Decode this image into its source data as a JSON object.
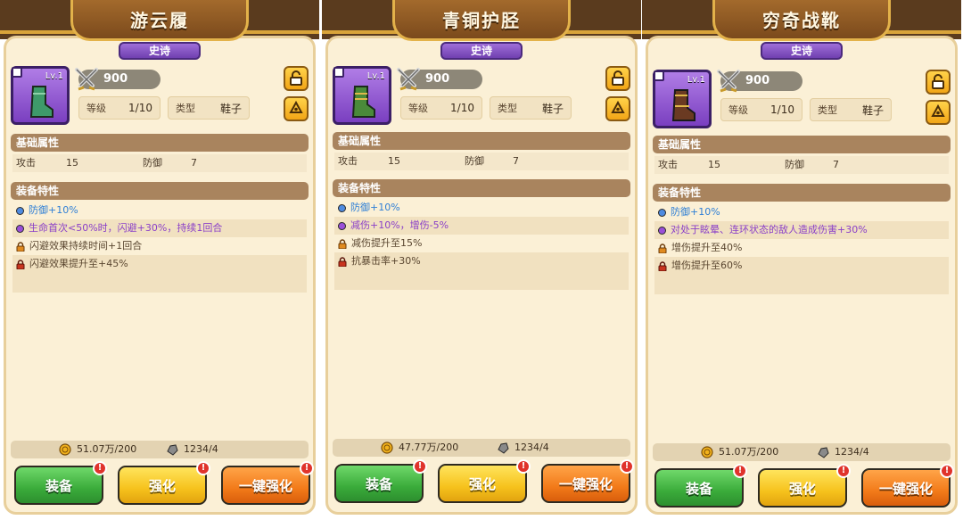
{
  "labels": {
    "level": "等级",
    "type": "类型",
    "basic_attrs": "基础属性",
    "equip_traits": "装备特性",
    "attack": "攻击",
    "defense": "防御",
    "btn_equip": "装备",
    "btn_upgrade": "强化",
    "btn_auto": "一键强化",
    "badge": "!",
    "icon_level": "Lv.1"
  },
  "panels": [
    {
      "title": "游云履",
      "rarity": "史诗",
      "power": "900",
      "level": "1/10",
      "type": "鞋子",
      "attack": "15",
      "defense": "7",
      "traits": [
        {
          "icon": "blue-dot",
          "text": "防御+10%"
        },
        {
          "icon": "purple-dot",
          "text": "生命首次<50%时，闪避+30%，持续1回合"
        },
        {
          "icon": "orange-lock",
          "text": "闪避效果持续时间+1回合"
        },
        {
          "icon": "red-lock",
          "text": "闪避效果提升至+45%"
        }
      ],
      "gold": "51.07万/200",
      "stone": "1234/4",
      "boot_color": "#3e9a6a"
    },
    {
      "title": "青铜护胫",
      "rarity": "史诗",
      "power": "900",
      "level": "1/10",
      "type": "鞋子",
      "attack": "15",
      "defense": "7",
      "traits": [
        {
          "icon": "blue-dot",
          "text": "防御+10%"
        },
        {
          "icon": "purple-dot",
          "text": "减伤+10%，增伤-5%"
        },
        {
          "icon": "orange-lock",
          "text": "减伤提升至15%"
        },
        {
          "icon": "red-lock",
          "text": "抗暴击率+30%"
        }
      ],
      "gold": "47.77万/200",
      "stone": "1234/4",
      "boot_color": "#4a8a3a"
    },
    {
      "title": "穷奇战靴",
      "rarity": "史诗",
      "power": "900",
      "level": "1/10",
      "type": "鞋子",
      "attack": "15",
      "defense": "7",
      "traits": [
        {
          "icon": "blue-dot",
          "text": "防御+10%"
        },
        {
          "icon": "purple-dot",
          "text": "对处于眩晕、连环状态的敌人造成伤害+30%"
        },
        {
          "icon": "orange-lock",
          "text": "增伤提升至40%"
        },
        {
          "icon": "red-lock",
          "text": "增伤提升至60%"
        }
      ],
      "gold": "51.07万/200",
      "stone": "1234/4",
      "boot_color": "#6a3a22"
    }
  ]
}
